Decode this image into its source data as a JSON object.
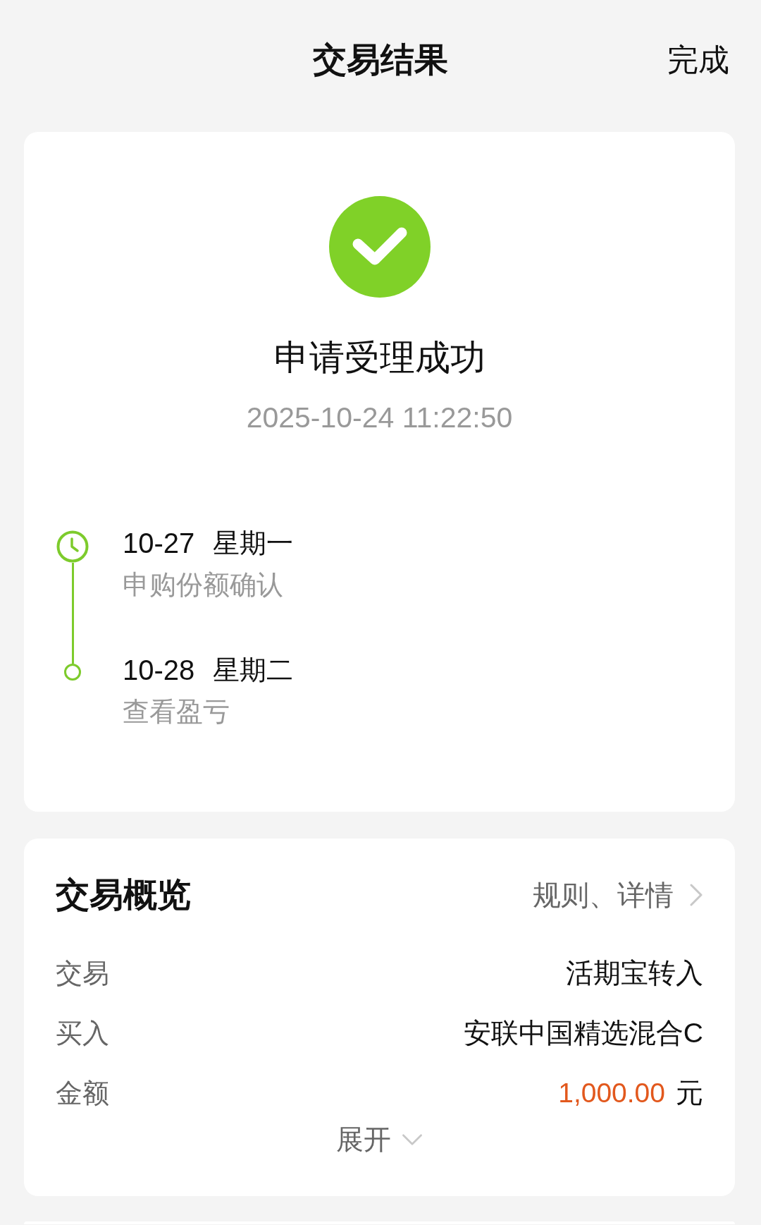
{
  "header": {
    "title": "交易结果",
    "action": "完成"
  },
  "result": {
    "kind": "success",
    "title": "申请受理成功",
    "time": "2025-10-24 11:22:50"
  },
  "timeline": [
    {
      "kind": "current",
      "date": "10-27",
      "weekday": "星期一",
      "description": "申购份额确认"
    },
    {
      "kind": "upcoming",
      "date": "10-28",
      "weekday": "星期二",
      "description": "查看盈亏"
    }
  ],
  "overview": {
    "title": "交易概览",
    "link": "规则、详情",
    "rows": [
      {
        "kind": "text",
        "label": "交易",
        "value": "活期宝转入"
      },
      {
        "kind": "text",
        "label": "买入",
        "value": "安联中国精选混合C"
      },
      {
        "kind": "amount",
        "label": "金额",
        "value": "1,000.00",
        "unit": "元"
      }
    ],
    "toggle": {
      "label": "展开",
      "expanded": false
    }
  }
}
